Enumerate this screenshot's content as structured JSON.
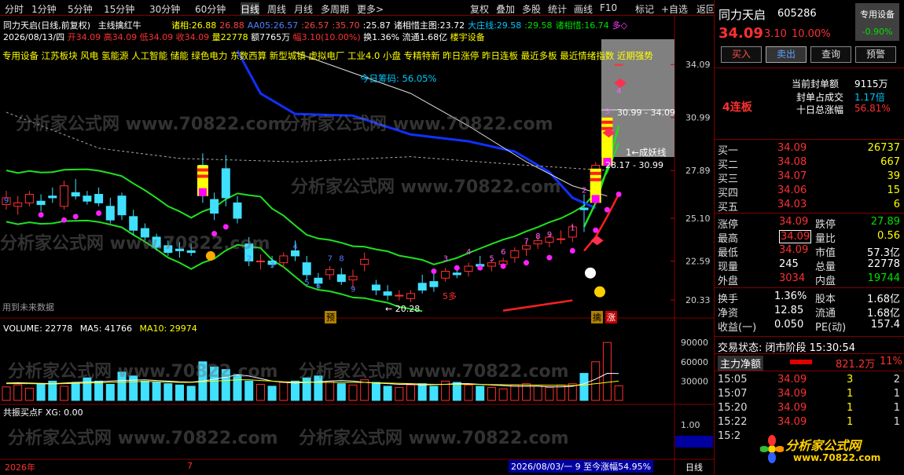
{
  "menu": [
    "分时",
    "1分钟",
    "5分钟",
    "15分钟",
    "30分钟",
    "60分钟",
    "日线",
    "周线",
    "月线",
    "多周期",
    "更多>"
  ],
  "menu_right": [
    "复权",
    "叠加",
    "多股",
    "统计",
    "画线",
    "F10",
    "标记",
    "+自选",
    "返回"
  ],
  "stock": {
    "name": "同力天启",
    "code": "605286",
    "sector_tag": "专用设备",
    "sector_change": "-0.90%",
    "price": "34.09",
    "change": "3.10",
    "change_pct": "10.00%"
  },
  "chart_header": {
    "title": "同力天启(日线,前复权)",
    "indicator": "主线擒红牛",
    "vals": [
      {
        "label": "诸相:",
        "value": "26.88"
      },
      {
        "label": "",
        "value": "26.88"
      },
      {
        "label": "AA05:",
        "value": "26.57"
      },
      {
        "label": ":",
        "value": "26.57"
      },
      {
        "label": ":",
        "value": "35.70"
      },
      {
        "label": ":",
        "value": "25.87"
      },
      {
        "label": "诸相惜主图:",
        "value": "23.72"
      },
      {
        "label": "大庄线:",
        "value": "29.58"
      },
      {
        "label": ":",
        "value": "29.58"
      },
      {
        "label": "诸相惜:",
        "value": "16.74"
      },
      {
        "label": "",
        "value": "多◇"
      }
    ]
  },
  "ohlc": {
    "date": "2026/08/13/四",
    "open": "开34.09",
    "high": "高34.09",
    "low": "低34.09",
    "close": "收34.09",
    "vol": "量22778",
    "amount": "额7765万",
    "range": "幅3.10(10.00%)",
    "turnover": "换1.36%",
    "float": "流通1.68亿",
    "extra": "楼宇设备"
  },
  "concepts": "专用设备 江苏板块 风电 氢能源 人工智能 储能 绿色电力 东数西算 新型城镇 虚拟电厂 工业4.0 小盘 专精特新 昨日涨停 昨日连板 最近多板 最近情绪指数 近期强势",
  "chip_label": "今日筹码: 56.05%",
  "chip_range_top": "30.99 - 34.09",
  "chip_range_bot": "28.17 - 30.99",
  "monster_line": "1←成妖线",
  "future_data": "用到未来数据",
  "low_label": "← 20.28",
  "five_more": "5多",
  "mark_yu": "预",
  "mark_qin": "擒",
  "mark_zhang": "涨",
  "price_axis": [
    "34.09",
    "30.99",
    "27.89",
    "25.10",
    "22.59",
    "20.33"
  ],
  "volume_header": {
    "label": "VOLUME:",
    "vol": "22778",
    "ma5_label": "MA5:",
    "ma5": "41766",
    "ma10_label": "MA10:",
    "ma10": "29974"
  },
  "volume_axis": [
    "90000",
    "60000",
    "30000"
  ],
  "sub_header": "共振买点F XG: 0.00",
  "sub_axis": [
    "1.00",
    "0.00"
  ],
  "bottom": {
    "year": "2026年",
    "month": "7",
    "range_info": "2026/08/03/一 9 至今涨幅54.95%",
    "period": "日线"
  },
  "seal": {
    "order_label": "当前封单额",
    "order_value": "9115万",
    "ratio_label": "封单占成交",
    "ratio_value": "1.17倍",
    "ten_label": "十日总涨幅",
    "ten_value": "56.81%",
    "boards": "4连板"
  },
  "bids": [
    {
      "label": "买一",
      "price": "34.09",
      "vol": "26737"
    },
    {
      "label": "买二",
      "price": "34.08",
      "vol": "667"
    },
    {
      "label": "买三",
      "price": "34.07",
      "vol": "39"
    },
    {
      "label": "买四",
      "price": "34.06",
      "vol": "15"
    },
    {
      "label": "买五",
      "price": "34.03",
      "vol": "6"
    }
  ],
  "stats": [
    {
      "l1": "涨停",
      "v1": "34.09",
      "l2": "跌停",
      "v2": "27.89"
    },
    {
      "l1": "最高",
      "v1": "34.09",
      "l2": "量比",
      "v2": "0.56"
    },
    {
      "l1": "最低",
      "v1": "34.09",
      "l2": "市值",
      "v2": "57.3亿"
    },
    {
      "l1": "现量",
      "v1": "245",
      "l2": "总量",
      "v2": "22778"
    },
    {
      "l1": "外盘",
      "v1": "3034",
      "l2": "内盘",
      "v2": "19744"
    }
  ],
  "stats2": [
    {
      "l1": "换手",
      "v1": "1.36%",
      "l2": "股本",
      "v2": "1.68亿"
    },
    {
      "l1": "净资",
      "v1": "12.85",
      "l2": "流通",
      "v2": "1.68亿"
    },
    {
      "l1": "收益(一)",
      "v1": "0.050",
      "l2": "PE(动)",
      "v2": "157.4"
    }
  ],
  "trade_status": "交易状态: 闭市阶段 15:30:54",
  "main_flow": {
    "label": "主力净额",
    "value": "821.2万",
    "pct": "11%"
  },
  "ticks": [
    {
      "time": "15:05",
      "price": "34.09",
      "vol": "3",
      "n": "2"
    },
    {
      "time": "15:07",
      "price": "34.09",
      "vol": "1",
      "n": "1"
    },
    {
      "time": "15:20",
      "price": "34.09",
      "vol": "1",
      "n": "1"
    },
    {
      "time": "15:22",
      "price": "34.09",
      "vol": "1",
      "n": "1"
    },
    {
      "time": "15:2",
      "price": "34.09",
      "vol": "",
      "n": ""
    }
  ],
  "brand": {
    "name": "分析家公式网",
    "url": "www.70822.com"
  },
  "watermark": "分析家公式网 www.70822.com",
  "buttons": [
    "买入",
    "卖出",
    "查询",
    "预警"
  ],
  "chart_data": {
    "type": "candlestick",
    "ylim": [
      19.5,
      35.2
    ],
    "candles": [
      [
        0,
        25.9,
        26.7,
        25.6,
        26.3
      ],
      [
        1,
        25.8,
        26.4,
        25.3,
        26.0
      ],
      [
        2,
        26.0,
        26.7,
        25.8,
        26.5
      ],
      [
        3,
        26.1,
        26.5,
        25.5,
        25.9
      ],
      [
        4,
        26.4,
        26.9,
        26.0,
        26.3
      ],
      [
        5,
        25.8,
        27.3,
        25.6,
        27.0
      ],
      [
        6,
        26.6,
        27.4,
        26.2,
        26.4
      ],
      [
        7,
        26.4,
        26.7,
        25.9,
        26.1
      ],
      [
        8,
        26.5,
        26.9,
        25.8,
        26.0
      ],
      [
        9,
        25.8,
        26.3,
        24.8,
        25.0
      ],
      [
        10,
        26.4,
        26.6,
        25.0,
        25.3
      ],
      [
        11,
        25.2,
        25.6,
        24.1,
        24.4
      ],
      [
        12,
        24.5,
        24.8,
        23.8,
        24.0
      ],
      [
        13,
        24.0,
        24.2,
        23.2,
        23.4
      ],
      [
        14,
        23.5,
        23.8,
        22.9,
        23.1
      ],
      [
        15,
        23.3,
        23.7,
        22.8,
        23.2
      ],
      [
        16,
        23.2,
        23.6,
        22.9,
        23.1
      ],
      [
        17,
        28.2,
        28.9,
        26.0,
        26.6
      ],
      [
        18,
        26.2,
        26.6,
        25.0,
        25.4
      ],
      [
        19,
        28.0,
        28.8,
        25.8,
        26.3
      ],
      [
        20,
        26.0,
        26.4,
        24.8,
        25.1
      ],
      [
        21,
        23.6,
        24.0,
        22.3,
        22.6
      ],
      [
        22,
        22.6,
        23.0,
        22.1,
        22.6
      ],
      [
        23,
        22.6,
        22.9,
        22.2,
        22.4
      ],
      [
        24,
        22.5,
        23.1,
        22.2,
        22.9
      ],
      [
        25,
        23.2,
        23.8,
        22.6,
        22.9
      ],
      [
        26,
        22.5,
        22.9,
        21.5,
        21.8
      ],
      [
        27,
        21.6,
        21.9,
        21.0,
        21.3
      ],
      [
        28,
        21.8,
        22.3,
        21.5,
        22.1
      ],
      [
        29,
        21.8,
        22.2,
        21.2,
        21.4
      ],
      [
        30,
        21.5,
        22.1,
        21.0,
        21.7
      ],
      [
        31,
        22.4,
        23.1,
        22.0,
        22.7
      ],
      [
        32,
        21.2,
        21.5,
        20.6,
        20.9
      ],
      [
        33,
        20.8,
        21.2,
        20.3,
        20.6
      ],
      [
        34,
        20.6,
        20.9,
        20.3,
        20.6
      ],
      [
        35,
        20.4,
        20.9,
        20.2,
        20.7
      ],
      [
        36,
        21.3,
        21.8,
        20.7,
        20.9
      ],
      [
        37,
        21.4,
        21.9,
        20.8,
        21.1
      ],
      [
        38,
        21.6,
        22.2,
        21.4,
        22.0
      ],
      [
        39,
        21.9,
        22.3,
        21.6,
        21.8
      ],
      [
        40,
        22.0,
        22.5,
        21.7,
        22.3
      ],
      [
        41,
        22.4,
        22.9,
        22.1,
        22.3
      ],
      [
        42,
        22.3,
        22.7,
        22.0,
        22.5
      ],
      [
        43,
        22.4,
        22.8,
        22.2,
        22.6
      ],
      [
        44,
        22.8,
        23.4,
        22.5,
        23.2
      ],
      [
        45,
        23.3,
        23.8,
        22.9,
        23.5
      ],
      [
        46,
        23.6,
        24.1,
        23.3,
        23.8
      ],
      [
        47,
        23.7,
        24.2,
        23.4,
        24.0
      ],
      [
        48,
        23.9,
        24.4,
        23.6,
        23.9
      ],
      [
        49,
        24.0,
        24.8,
        23.7,
        24.6
      ],
      [
        50,
        25.7,
        26.5,
        24.3,
        25.6
      ],
      [
        51,
        26.5,
        28.4,
        25.9,
        28.2
      ],
      [
        52,
        30.99,
        30.99,
        28.17,
        30.99
      ],
      [
        53,
        34.09,
        34.09,
        34.09,
        34.09
      ]
    ],
    "volume": [
      21000,
      24000,
      19000,
      26000,
      30000,
      22000,
      28000,
      35000,
      30000,
      25000,
      44000,
      38000,
      30000,
      28000,
      26000,
      24000,
      22000,
      60000,
      52000,
      48000,
      40000,
      30000,
      25000,
      22000,
      28000,
      30000,
      35000,
      38000,
      30000,
      26000,
      24000,
      32000,
      28000,
      22000,
      20000,
      24000,
      26000,
      22000,
      30000,
      28000,
      24000,
      22000,
      20000,
      18000,
      24000,
      26000,
      22000,
      20000,
      24000,
      26000,
      42000,
      60000,
      90000,
      22778
    ],
    "ma5": [
      27000,
      27500,
      27000,
      26500,
      26000,
      27000,
      28000,
      28500,
      29000,
      30000,
      31000,
      31500,
      32000,
      31000,
      30000,
      29000,
      28500,
      30000,
      33000,
      36000,
      40000,
      38000,
      34000,
      30000,
      28000,
      27000,
      28000,
      29000,
      30000,
      31000,
      30000,
      28000,
      27000,
      26000,
      25000,
      25000,
      24000,
      24500,
      25000,
      26000,
      26000,
      25000,
      24000,
      23000,
      22000,
      22000,
      22000,
      21000,
      21000,
      22000,
      26000,
      33000,
      42000,
      41766
    ],
    "ma10": [
      26000,
      26200,
      26000,
      25800,
      25600,
      26000,
      26500,
      27000,
      27500,
      28000,
      28500,
      29000,
      29500,
      29000,
      28500,
      28000,
      28000,
      29000,
      30000,
      31000,
      32000,
      32000,
      31000,
      30000,
      29000,
      28500,
      28500,
      28000,
      28000,
      28000,
      28000,
      28000,
      27500,
      27000,
      26500,
      26000,
      25500,
      25000,
      25000,
      25000,
      25000,
      24800,
      24600,
      24400,
      24200,
      24000,
      23800,
      23600,
      23400,
      23200,
      24000,
      26000,
      28000,
      29974
    ]
  }
}
